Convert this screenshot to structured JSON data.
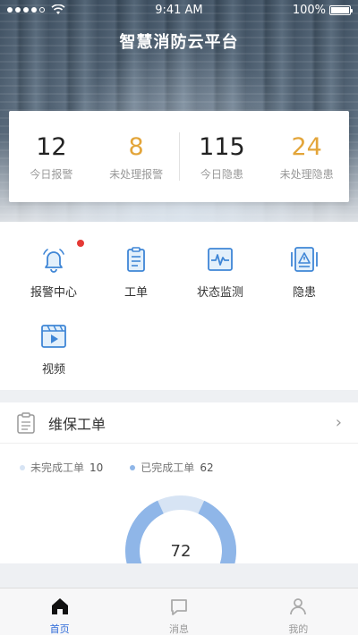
{
  "status_bar": {
    "time": "9:41 AM",
    "battery": "100%"
  },
  "app_title": "智慧消防云平台",
  "stats": [
    {
      "value": "12",
      "label": "今日报警"
    },
    {
      "value": "8",
      "label": "未处理报警"
    },
    {
      "value": "115",
      "label": "今日隐患"
    },
    {
      "value": "24",
      "label": "未处理隐患"
    }
  ],
  "functions": [
    {
      "label": "报警中心",
      "icon": "alarm-bell-icon"
    },
    {
      "label": "工单",
      "icon": "clipboard-icon"
    },
    {
      "label": "状态监测",
      "icon": "monitor-pulse-icon"
    },
    {
      "label": "隐患",
      "icon": "warning-panel-icon"
    },
    {
      "label": "视频",
      "icon": "video-icon"
    }
  ],
  "maintenance": {
    "title": "维保工单",
    "legend": [
      {
        "label": "未完成工单",
        "value": "10",
        "color": "#d7e4f4"
      },
      {
        "label": "已完成工单",
        "value": "62",
        "color": "#8fb6e8"
      }
    ],
    "total": "72"
  },
  "tabs": [
    {
      "label": "首页",
      "icon": "home-icon"
    },
    {
      "label": "消息",
      "icon": "message-icon"
    },
    {
      "label": "我的",
      "icon": "user-icon"
    }
  ],
  "colors": {
    "accent": "#2f6bd9",
    "warning": "#e3a53a",
    "icon_blue": "#3f86d6",
    "badge_red": "#e53935"
  }
}
